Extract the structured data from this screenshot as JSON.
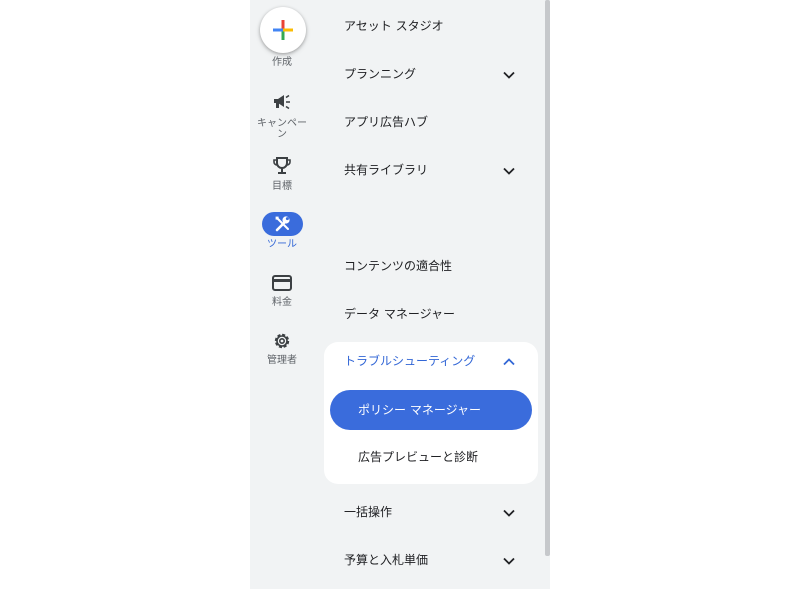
{
  "rail": {
    "create_label": "作成",
    "campaign_label_1": "キャンペー",
    "campaign_label_2": "ン",
    "goals_label": "目標",
    "tools_label": "ツール",
    "billing_label": "料金",
    "admin_label": "管理者"
  },
  "menu": {
    "asset_studio": "アセット スタジオ",
    "planning": "プランニング",
    "app_ads_hub": "アプリ広告ハブ",
    "shared_library": "共有ライブラリ",
    "content_suitability": "コンテンツの適合性",
    "data_manager": "データ マネージャー",
    "troubleshooting": "トラブルシューティング",
    "policy_manager": "ポリシー マネージャー",
    "ad_preview": "広告プレビューと診断",
    "bulk_actions": "一括操作",
    "budgets_bidding": "予算と入札単価"
  },
  "colors": {
    "accent": "#3a6cdc",
    "accent_text": "#3367d6",
    "panel_bg": "#f1f3f4",
    "plus_red": "#ea4335",
    "plus_blue": "#4285f4",
    "plus_yellow": "#fbbc04",
    "plus_green": "#34a853"
  },
  "icons": {
    "create": "plus-icon",
    "campaigns": "megaphone-icon",
    "goals": "trophy-icon",
    "tools": "wrench-icon",
    "billing": "credit-card-icon",
    "admin": "gear-icon",
    "expand": "chevron-down-icon",
    "collapse": "chevron-up-icon"
  }
}
